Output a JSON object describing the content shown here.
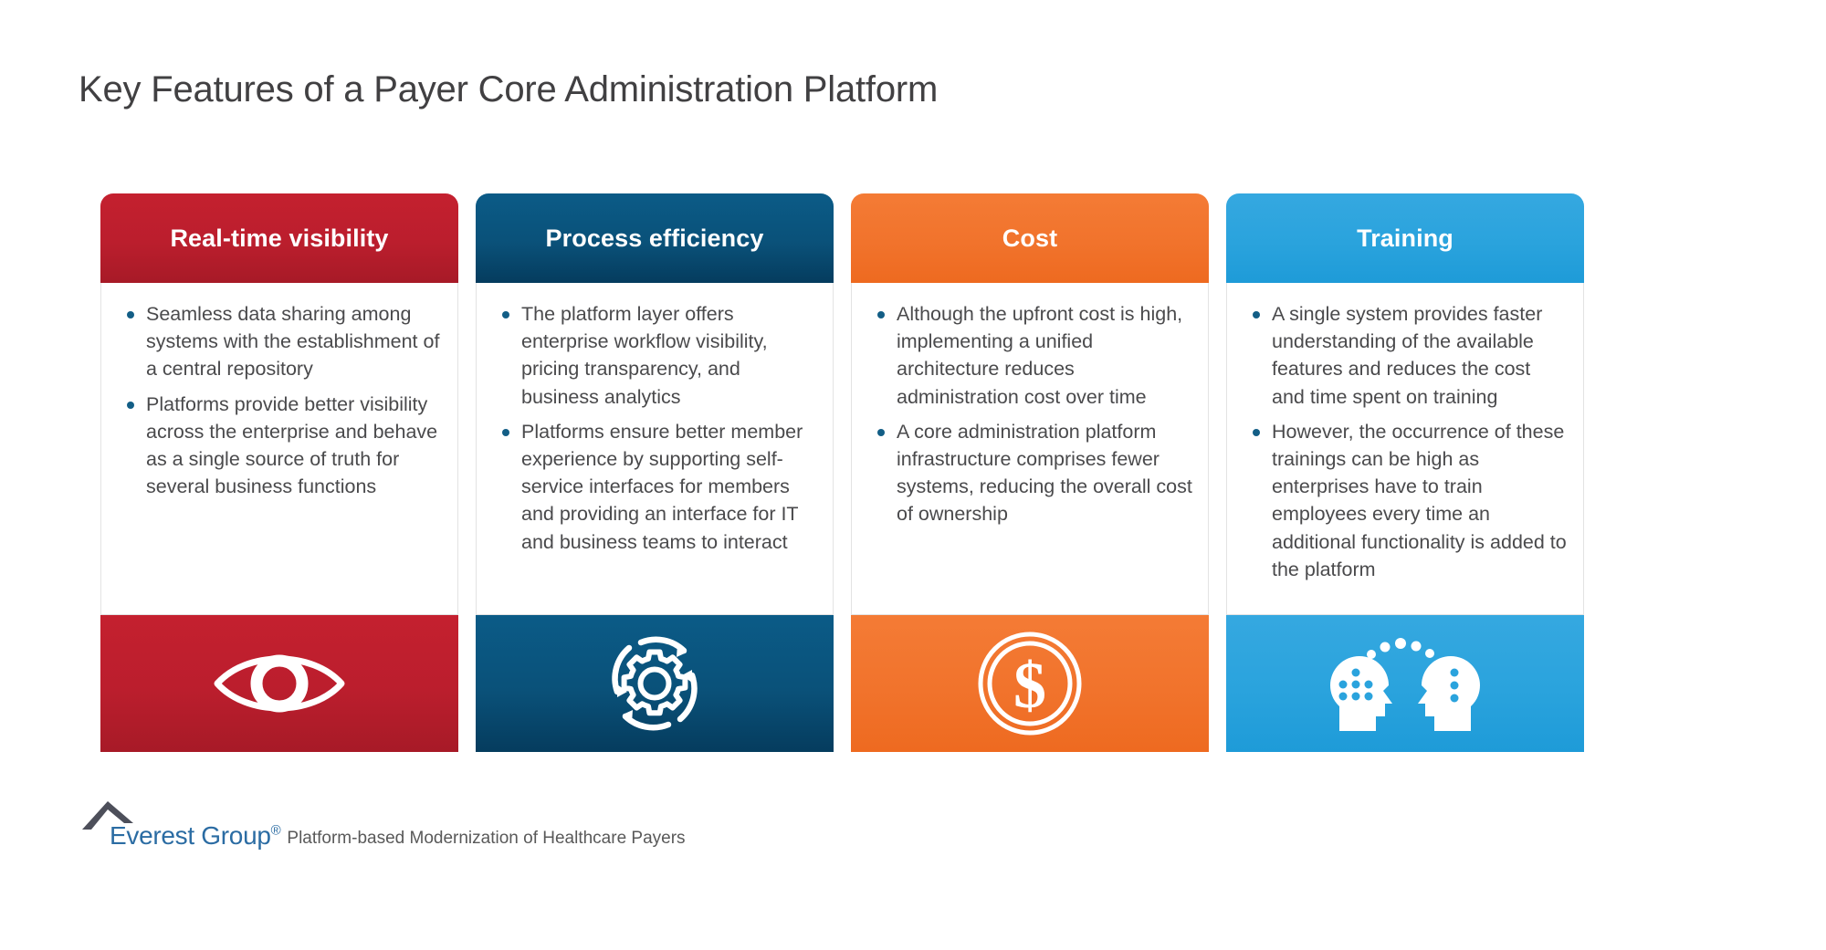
{
  "slide": {
    "title": "Key Features of a Payer Core Administration Platform"
  },
  "colors": {
    "red": "#c4202f",
    "navy": "#0b5b87",
    "orange": "#f47b35",
    "blue": "#35a8e0",
    "bullet": "#135e86",
    "body_text": "#4a4a4c",
    "title_text": "#414042",
    "logo_blue": "#2b6ca3",
    "logo_peak": "#4d4f5a"
  },
  "cards": [
    {
      "title": "Real-time visibility",
      "icon": "eye-icon",
      "accent": "red",
      "bullets": [
        "Seamless data sharing among systems with the establishment of a central repository",
        "Platforms provide better visibility across the enterprise and behave as a single source of truth for several business functions"
      ]
    },
    {
      "title": "Process efficiency",
      "icon": "gear-cycle-icon",
      "accent": "navy",
      "bullets": [
        "The platform layer offers enterprise workflow visibility, pricing transparency, and business analytics",
        "Platforms ensure better member experience  by supporting self-service interfaces for members and providing an interface for IT and business teams to interact"
      ]
    },
    {
      "title": "Cost",
      "icon": "dollar-coin-icon",
      "accent": "orange",
      "bullets": [
        "Although the upfront cost is high, implementing a unified architecture reduces administration cost over time",
        "A core administration platform infrastructure comprises fewer systems, reducing the overall cost of ownership"
      ]
    },
    {
      "title": "Training",
      "icon": "knowledge-transfer-icon",
      "accent": "blue",
      "bullets": [
        "A single system provides faster understanding of the available features and reduces the cost and time spent on training",
        "However, the occurrence of these trainings can be high as enterprises have to train employees every time an additional functionality is added to the platform"
      ]
    }
  ],
  "footer": {
    "logo_name": "Everest Group",
    "logo_registered": "®",
    "caption": "Platform-based Modernization of Healthcare Payers"
  }
}
